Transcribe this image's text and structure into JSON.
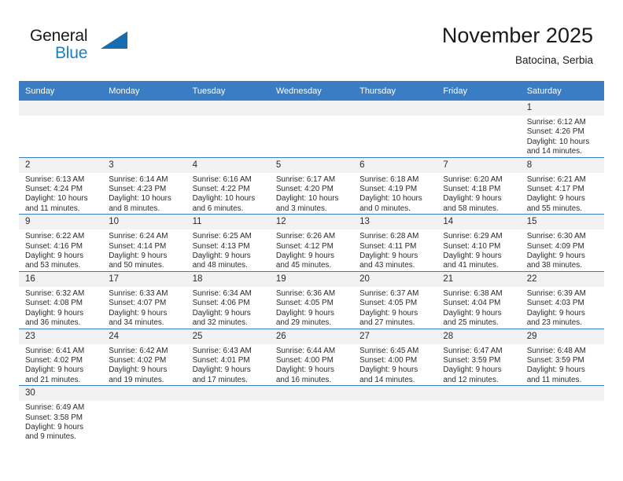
{
  "brand": {
    "name_line1": "General",
    "name_line2": "Blue",
    "flag_icon": "triangle-flag-icon",
    "accent_color": "#1a7fc1"
  },
  "header": {
    "month_title": "November 2025",
    "location": "Batocina, Serbia"
  },
  "theme": {
    "header_row_bg": "#3b7dc4",
    "header_row_text": "#ffffff",
    "daynum_bg": "#f2f2f2",
    "grid_line": "#3b7dc4",
    "body_text": "#2b2b2b"
  },
  "calendar": {
    "weekday_headers": [
      "Sunday",
      "Monday",
      "Tuesday",
      "Wednesday",
      "Thursday",
      "Friday",
      "Saturday"
    ],
    "weeks": [
      [
        {
          "day": "",
          "text": "",
          "empty": true
        },
        {
          "day": "",
          "text": "",
          "empty": true
        },
        {
          "day": "",
          "text": "",
          "empty": true
        },
        {
          "day": "",
          "text": "",
          "empty": true
        },
        {
          "day": "",
          "text": "",
          "empty": true
        },
        {
          "day": "",
          "text": "",
          "empty": true
        },
        {
          "day": "1",
          "text": "Sunrise: 6:12 AM\nSunset: 4:26 PM\nDaylight: 10 hours\nand 14 minutes."
        }
      ],
      [
        {
          "day": "2",
          "text": "Sunrise: 6:13 AM\nSunset: 4:24 PM\nDaylight: 10 hours\nand 11 minutes."
        },
        {
          "day": "3",
          "text": "Sunrise: 6:14 AM\nSunset: 4:23 PM\nDaylight: 10 hours\nand 8 minutes."
        },
        {
          "day": "4",
          "text": "Sunrise: 6:16 AM\nSunset: 4:22 PM\nDaylight: 10 hours\nand 6 minutes."
        },
        {
          "day": "5",
          "text": "Sunrise: 6:17 AM\nSunset: 4:20 PM\nDaylight: 10 hours\nand 3 minutes."
        },
        {
          "day": "6",
          "text": "Sunrise: 6:18 AM\nSunset: 4:19 PM\nDaylight: 10 hours\nand 0 minutes."
        },
        {
          "day": "7",
          "text": "Sunrise: 6:20 AM\nSunset: 4:18 PM\nDaylight: 9 hours\nand 58 minutes."
        },
        {
          "day": "8",
          "text": "Sunrise: 6:21 AM\nSunset: 4:17 PM\nDaylight: 9 hours\nand 55 minutes."
        }
      ],
      [
        {
          "day": "9",
          "text": "Sunrise: 6:22 AM\nSunset: 4:16 PM\nDaylight: 9 hours\nand 53 minutes."
        },
        {
          "day": "10",
          "text": "Sunrise: 6:24 AM\nSunset: 4:14 PM\nDaylight: 9 hours\nand 50 minutes."
        },
        {
          "day": "11",
          "text": "Sunrise: 6:25 AM\nSunset: 4:13 PM\nDaylight: 9 hours\nand 48 minutes."
        },
        {
          "day": "12",
          "text": "Sunrise: 6:26 AM\nSunset: 4:12 PM\nDaylight: 9 hours\nand 45 minutes."
        },
        {
          "day": "13",
          "text": "Sunrise: 6:28 AM\nSunset: 4:11 PM\nDaylight: 9 hours\nand 43 minutes."
        },
        {
          "day": "14",
          "text": "Sunrise: 6:29 AM\nSunset: 4:10 PM\nDaylight: 9 hours\nand 41 minutes."
        },
        {
          "day": "15",
          "text": "Sunrise: 6:30 AM\nSunset: 4:09 PM\nDaylight: 9 hours\nand 38 minutes."
        }
      ],
      [
        {
          "day": "16",
          "text": "Sunrise: 6:32 AM\nSunset: 4:08 PM\nDaylight: 9 hours\nand 36 minutes."
        },
        {
          "day": "17",
          "text": "Sunrise: 6:33 AM\nSunset: 4:07 PM\nDaylight: 9 hours\nand 34 minutes."
        },
        {
          "day": "18",
          "text": "Sunrise: 6:34 AM\nSunset: 4:06 PM\nDaylight: 9 hours\nand 32 minutes."
        },
        {
          "day": "19",
          "text": "Sunrise: 6:36 AM\nSunset: 4:05 PM\nDaylight: 9 hours\nand 29 minutes."
        },
        {
          "day": "20",
          "text": "Sunrise: 6:37 AM\nSunset: 4:05 PM\nDaylight: 9 hours\nand 27 minutes."
        },
        {
          "day": "21",
          "text": "Sunrise: 6:38 AM\nSunset: 4:04 PM\nDaylight: 9 hours\nand 25 minutes."
        },
        {
          "day": "22",
          "text": "Sunrise: 6:39 AM\nSunset: 4:03 PM\nDaylight: 9 hours\nand 23 minutes."
        }
      ],
      [
        {
          "day": "23",
          "text": "Sunrise: 6:41 AM\nSunset: 4:02 PM\nDaylight: 9 hours\nand 21 minutes."
        },
        {
          "day": "24",
          "text": "Sunrise: 6:42 AM\nSunset: 4:02 PM\nDaylight: 9 hours\nand 19 minutes."
        },
        {
          "day": "25",
          "text": "Sunrise: 6:43 AM\nSunset: 4:01 PM\nDaylight: 9 hours\nand 17 minutes."
        },
        {
          "day": "26",
          "text": "Sunrise: 6:44 AM\nSunset: 4:00 PM\nDaylight: 9 hours\nand 16 minutes."
        },
        {
          "day": "27",
          "text": "Sunrise: 6:45 AM\nSunset: 4:00 PM\nDaylight: 9 hours\nand 14 minutes."
        },
        {
          "day": "28",
          "text": "Sunrise: 6:47 AM\nSunset: 3:59 PM\nDaylight: 9 hours\nand 12 minutes."
        },
        {
          "day": "29",
          "text": "Sunrise: 6:48 AM\nSunset: 3:59 PM\nDaylight: 9 hours\nand 11 minutes."
        }
      ],
      [
        {
          "day": "30",
          "text": "Sunrise: 6:49 AM\nSunset: 3:58 PM\nDaylight: 9 hours\nand 9 minutes."
        },
        {
          "day": "",
          "text": "",
          "empty": true
        },
        {
          "day": "",
          "text": "",
          "empty": true
        },
        {
          "day": "",
          "text": "",
          "empty": true
        },
        {
          "day": "",
          "text": "",
          "empty": true
        },
        {
          "day": "",
          "text": "",
          "empty": true
        },
        {
          "day": "",
          "text": "",
          "empty": true
        }
      ]
    ]
  }
}
